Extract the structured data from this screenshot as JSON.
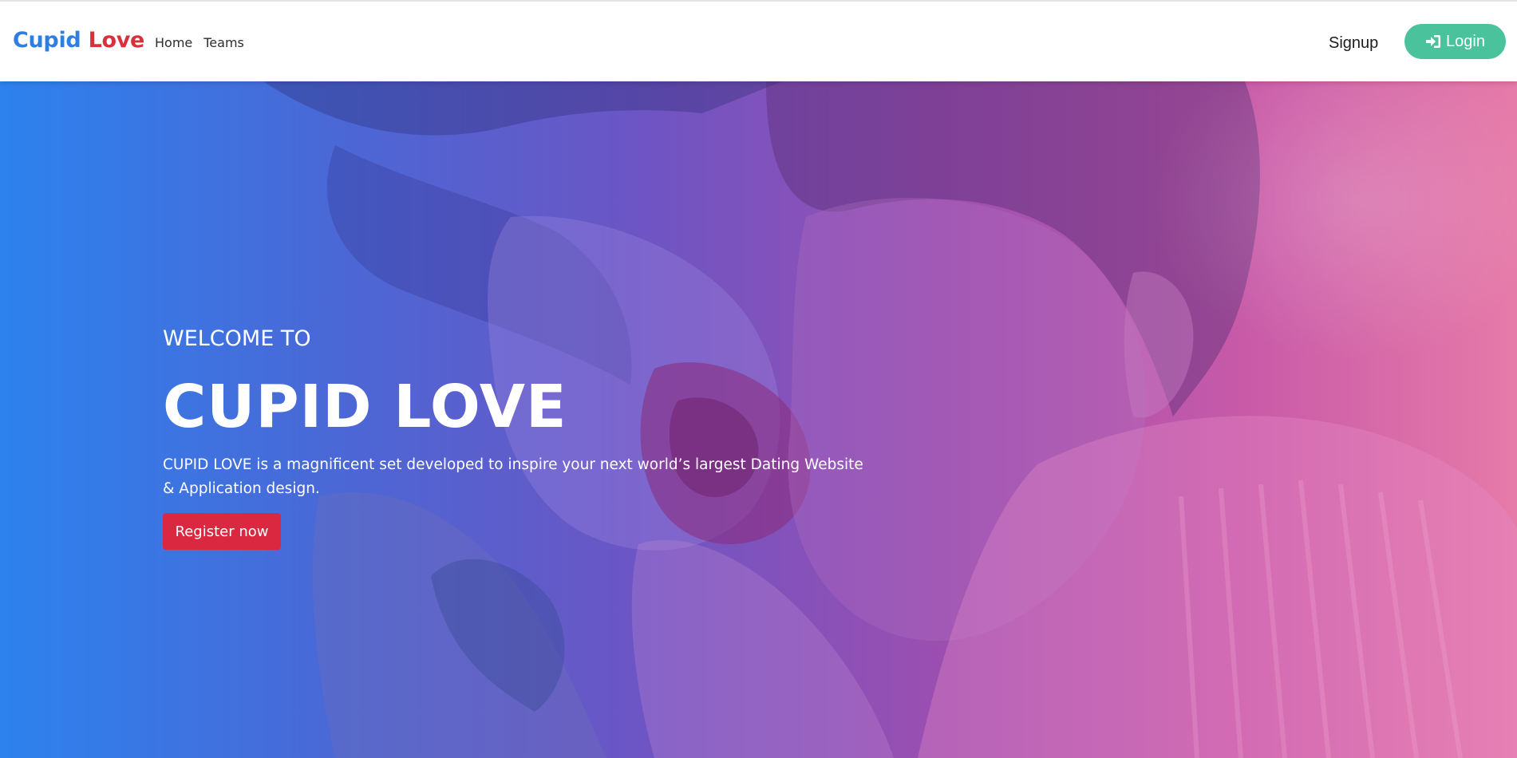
{
  "navbar": {
    "brand_first": "Cupid",
    "brand_second": "Love",
    "links": [
      "Home",
      "Teams"
    ],
    "signup_label": "Signup",
    "login_label": "Login",
    "login_icon": "sign-in-icon"
  },
  "hero": {
    "welcome": "WELCOME TO",
    "title": "CUPID LOVE",
    "description": "CUPID LOVE is a magnificent set developed to inspire your next world’s largest Dating Website & Application design.",
    "register_label": "Register now",
    "background_image": "couple-with-rose-photo"
  },
  "colors": {
    "brand_blue": "#2f7fe2",
    "brand_red": "#dc2f3c",
    "login_green": "#4ac29c",
    "register_red": "#d9283f",
    "gradient_start": "#2d82ee",
    "gradient_end": "#e67aa8"
  }
}
